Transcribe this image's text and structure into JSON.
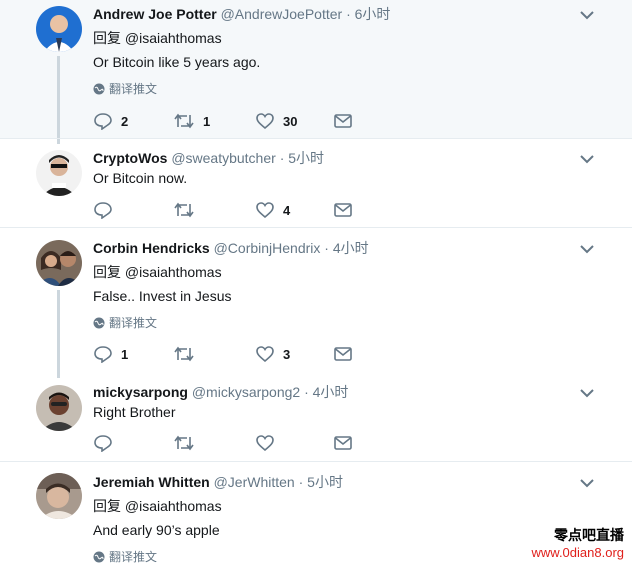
{
  "tweets": [
    {
      "name": "Andrew Joe Potter",
      "handle": "@AndrewJoePotter",
      "time": "· 6小时",
      "reply_prefix": "回复",
      "reply_to": "@isaiahthomas",
      "text": "Or Bitcoin like 5 years ago.",
      "translate": "翻译推文",
      "replies": "2",
      "retweets": "1",
      "likes": "30"
    },
    {
      "name": "CryptoWos",
      "handle": "@sweatybutcher",
      "time": "· 5小时",
      "text": "Or Bitcoin now.",
      "replies": "",
      "retweets": "",
      "likes": "4"
    },
    {
      "name": "Corbin Hendricks",
      "handle": "@CorbinjHendrix",
      "time": "· 4小时",
      "reply_prefix": "回复",
      "reply_to": "@isaiahthomas",
      "text": "False.. Invest in Jesus",
      "translate": "翻译推文",
      "replies": "1",
      "retweets": "",
      "likes": "3"
    },
    {
      "name": "mickysarpong",
      "handle": "@mickysarpong2",
      "time": "· 4小时",
      "text": "Right Brother",
      "replies": "",
      "retweets": "",
      "likes": ""
    },
    {
      "name": "Jeremiah Whitten",
      "handle": "@JerWhitten",
      "time": "· 5小时",
      "reply_prefix": "回复",
      "reply_to": "@isaiahthomas",
      "text": "And early 90’s apple",
      "translate": "翻译推文"
    }
  ],
  "watermark": {
    "line1": "零点吧直播",
    "line2": "www.0dian8.org"
  },
  "colors": {
    "highlight_bg": "#f5f8fa",
    "muted": "#657786",
    "divider": "#e6ecf0"
  }
}
